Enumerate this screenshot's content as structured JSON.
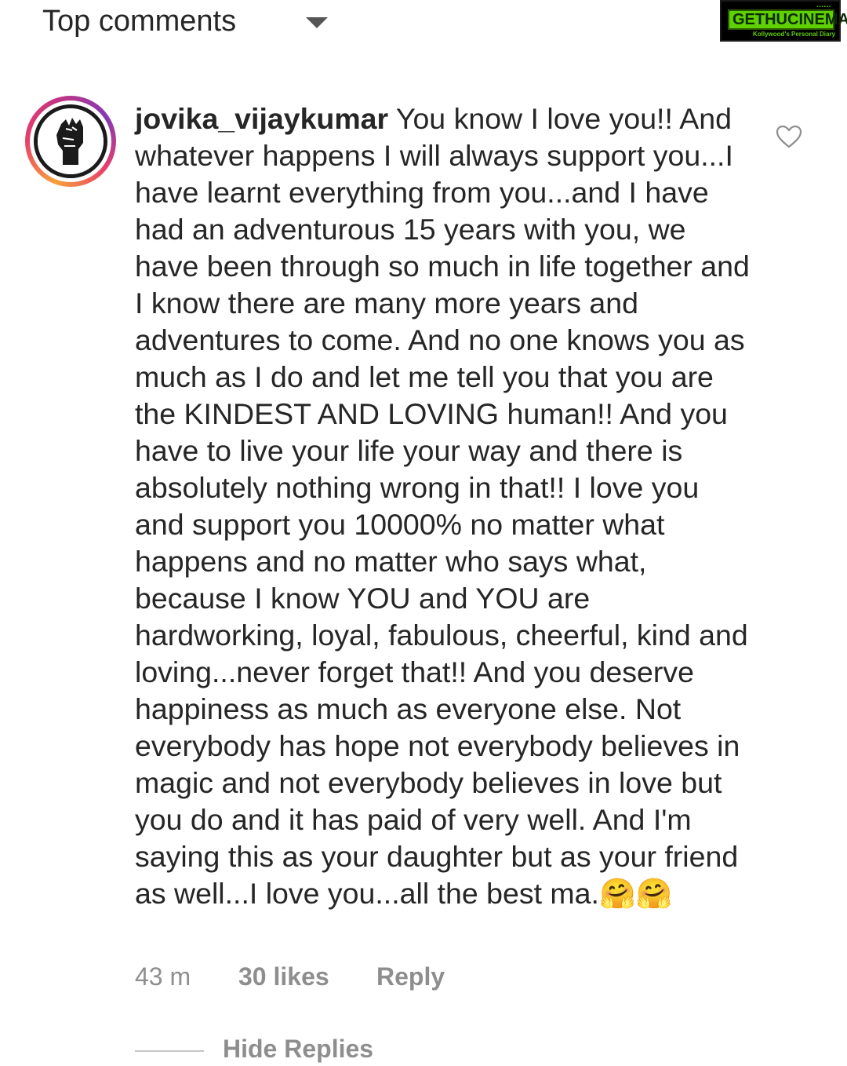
{
  "header": {
    "sort_label": "Top comments",
    "watermark_title": "GETHUCINEMA",
    "watermark_subtitle": "Kollywood's Personal Diary"
  },
  "comment": {
    "username": "jovika_vijaykumar",
    "text": " You know I love you!! And whatever happens I will always support you...I have learnt everything from you...and I have had an adventurous 15 years with you, we have been through so much in life together and I know there are many more years and adventures to come. And no one knows you as much as I do and let me tell you that you are the KINDEST AND LOVING human!! And you have to live your life your way and there is absolutely nothing wrong in that!! I love you and support you 10000% no matter what happens and no matter who says what, because I know YOU and YOU are hardworking, loyal,  fabulous, cheerful, kind and loving...never forget that!! And you deserve happiness as much as everyone else. Not everybody has hope not everybody believes in magic and not everybody believes in love but you do and it has paid of very well. And I'm saying this as your daughter but as your friend as well...I love you...all the best ma.🤗🤗",
    "time": "43 m",
    "likes": "30 likes",
    "reply_label": "Reply",
    "avatar_icon": "raised-fist-icon",
    "like_icon": "heart-outline-icon"
  },
  "replies": {
    "toggle_label": "Hide Replies"
  },
  "colors": {
    "text": "#262626",
    "secondary": "#8e8e8e",
    "watermark_green": "#5fd000"
  }
}
